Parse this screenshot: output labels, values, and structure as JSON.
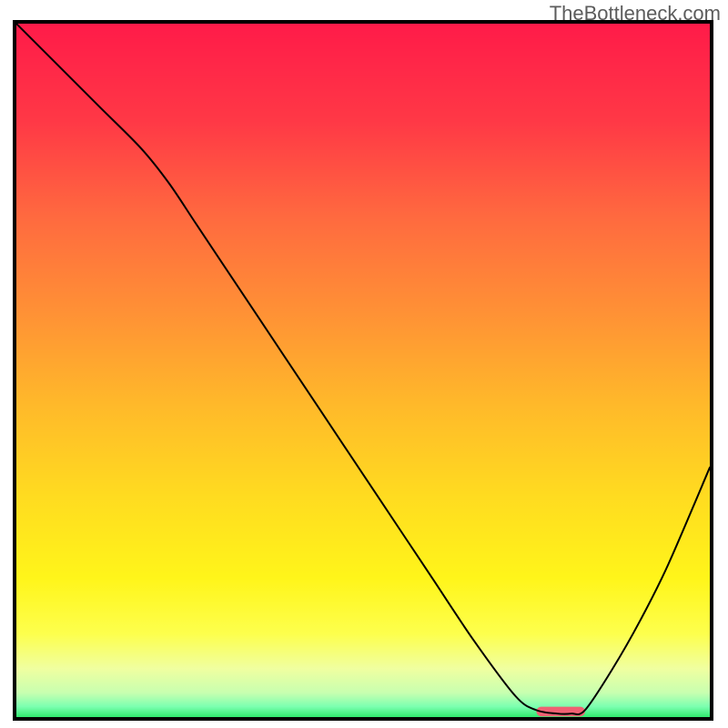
{
  "attribution": "TheBottleneck.com",
  "chart_data": {
    "type": "line",
    "title": "",
    "xlabel": "",
    "ylabel": "",
    "xlim": [
      0,
      100
    ],
    "ylim": [
      0,
      100
    ],
    "series": [
      {
        "name": "curve",
        "x": [
          0,
          6,
          12,
          18,
          22,
          26,
          32,
          38,
          44,
          50,
          56,
          60,
          66,
          72,
          75,
          78,
          80,
          82,
          86,
          90,
          94,
          100
        ],
        "values": [
          100,
          94,
          88,
          82,
          77,
          71,
          62,
          53,
          44,
          35,
          26,
          20,
          11,
          3,
          1,
          0.5,
          0.5,
          1,
          7,
          14,
          22,
          36
        ],
        "color": "#000000",
        "width": 2
      }
    ],
    "markers": [
      {
        "name": "low-segment",
        "x0": 75,
        "x1": 82,
        "y": 0.8,
        "thickness": 1.4,
        "color": "#ef6173"
      }
    ],
    "background": {
      "type": "vertical-gradient",
      "stops": [
        {
          "pos": 0.0,
          "color": "#ff1b49"
        },
        {
          "pos": 0.14,
          "color": "#ff3846"
        },
        {
          "pos": 0.28,
          "color": "#ff6a3f"
        },
        {
          "pos": 0.42,
          "color": "#ff9235"
        },
        {
          "pos": 0.55,
          "color": "#ffb92a"
        },
        {
          "pos": 0.68,
          "color": "#ffdb20"
        },
        {
          "pos": 0.8,
          "color": "#fff51a"
        },
        {
          "pos": 0.88,
          "color": "#fdff4d"
        },
        {
          "pos": 0.93,
          "color": "#f0ffa0"
        },
        {
          "pos": 0.965,
          "color": "#c8ffb0"
        },
        {
          "pos": 0.985,
          "color": "#7bffb0"
        },
        {
          "pos": 1.0,
          "color": "#30e96e"
        }
      ]
    }
  }
}
